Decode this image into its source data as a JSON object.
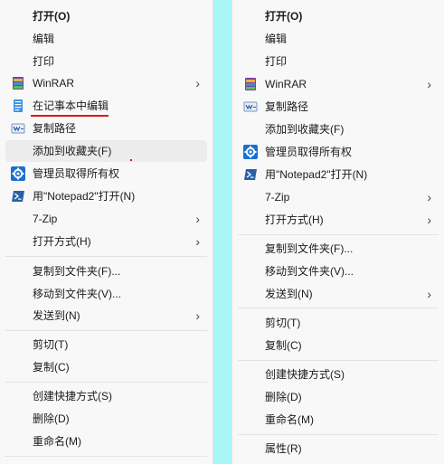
{
  "left_menu": {
    "items": [
      {
        "label": "打开(O)"
      },
      {
        "label": "编辑"
      },
      {
        "label": "打印"
      },
      {
        "label": "WinRAR",
        "arrow": "›"
      },
      {
        "label": "在记事本中编辑"
      },
      {
        "label": "复制路径"
      },
      {
        "label": "添加到收藏夹(F)"
      },
      {
        "label": "管理员取得所有权"
      },
      {
        "label": "用\"Notepad2\"打开(N)"
      },
      {
        "label": "7-Zip",
        "arrow": "›"
      },
      {
        "label": "打开方式(H)",
        "arrow": "›"
      },
      {
        "label": "复制到文件夹(F)..."
      },
      {
        "label": "移动到文件夹(V)..."
      },
      {
        "label": "发送到(N)",
        "arrow": "›"
      },
      {
        "label": "剪切(T)"
      },
      {
        "label": "复制(C)"
      },
      {
        "label": "创建快捷方式(S)"
      },
      {
        "label": "删除(D)"
      },
      {
        "label": "重命名(M)"
      }
    ]
  },
  "right_menu": {
    "items": [
      {
        "label": "打开(O)"
      },
      {
        "label": "编辑"
      },
      {
        "label": "打印"
      },
      {
        "label": "WinRAR",
        "arrow": "›"
      },
      {
        "label": "复制路径"
      },
      {
        "label": "添加到收藏夹(F)"
      },
      {
        "label": "管理员取得所有权"
      },
      {
        "label": "用\"Notepad2\"打开(N)"
      },
      {
        "label": "7-Zip",
        "arrow": "›"
      },
      {
        "label": "打开方式(H)",
        "arrow": "›"
      },
      {
        "label": "复制到文件夹(F)..."
      },
      {
        "label": "移动到文件夹(V)..."
      },
      {
        "label": "发送到(N)",
        "arrow": "›"
      },
      {
        "label": "剪切(T)"
      },
      {
        "label": "复制(C)"
      },
      {
        "label": "创建快捷方式(S)"
      },
      {
        "label": "删除(D)"
      },
      {
        "label": "重命名(M)"
      },
      {
        "label": "属性(R)"
      }
    ]
  },
  "colors": {
    "backdrop": "#a7f7f7",
    "menu_bg": "#f8f8f8",
    "hover_bg": "#ececec",
    "annotation_red": "#e21515",
    "gear_blue": "#1a6fd1",
    "powershell_blue": "#2a5fa8"
  },
  "icons": {
    "winrar": "winrar-icon",
    "notepad": "notepad-icon",
    "copy_path": "copy-path-icon",
    "admin_gear": "gear-icon",
    "notepad2": "powershell-icon"
  }
}
